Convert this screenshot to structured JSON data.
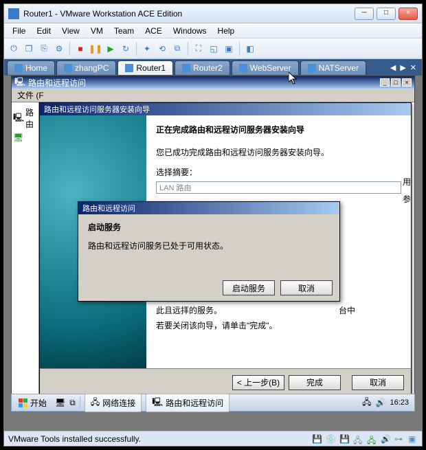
{
  "window": {
    "title": "Router1 - VMware Workstation ACE Edition",
    "min": "─",
    "max": "□",
    "close": "×"
  },
  "menu": [
    "File",
    "Edit",
    "View",
    "VM",
    "Team",
    "ACE",
    "Windows",
    "Help"
  ],
  "tabs": [
    {
      "label": "Home",
      "active": false
    },
    {
      "label": "zhangPC",
      "active": false
    },
    {
      "label": "Router1",
      "active": true
    },
    {
      "label": "Router2",
      "active": false
    },
    {
      "label": "WebServer",
      "active": false
    },
    {
      "label": "NATServer",
      "active": false
    }
  ],
  "tab_ctrl": {
    "left": "◀",
    "right": "▶",
    "close": "✕"
  },
  "inner": {
    "title": "路由和远程访问",
    "file": "文件 (F",
    "tree_root": "路由"
  },
  "wizard": {
    "title": "路由和远程访问服务器安装向导",
    "heading": "正在完成路由和远程访问服务器安装向导",
    "text1": "您已成功完成路由和远程访问服务器安装向导。",
    "summary_label": "选择摘要：",
    "summary_value": "LAN 路由",
    "right_frag1": "用",
    "right_frag2": "参",
    "overlay1": "台中",
    "overlay2": "若要关闭该向导，请单击\"完成\"。",
    "overlay_partial": "此且远拝的服务。",
    "buttons": {
      "back": "< 上一步(B)",
      "finish": "完成",
      "cancel": "取消"
    }
  },
  "dialog": {
    "title": "路由和远程访问",
    "heading": "启动服务",
    "text": "路由和远程访问服务已处于可用状态。",
    "buttons": {
      "start": "启动服务",
      "cancel": "取消"
    }
  },
  "taskbar": {
    "start": "开始",
    "items": [
      "网络连接",
      "路由和远程访问"
    ],
    "time": "16:23"
  },
  "status": {
    "msg": "VMware Tools installed successfully."
  }
}
